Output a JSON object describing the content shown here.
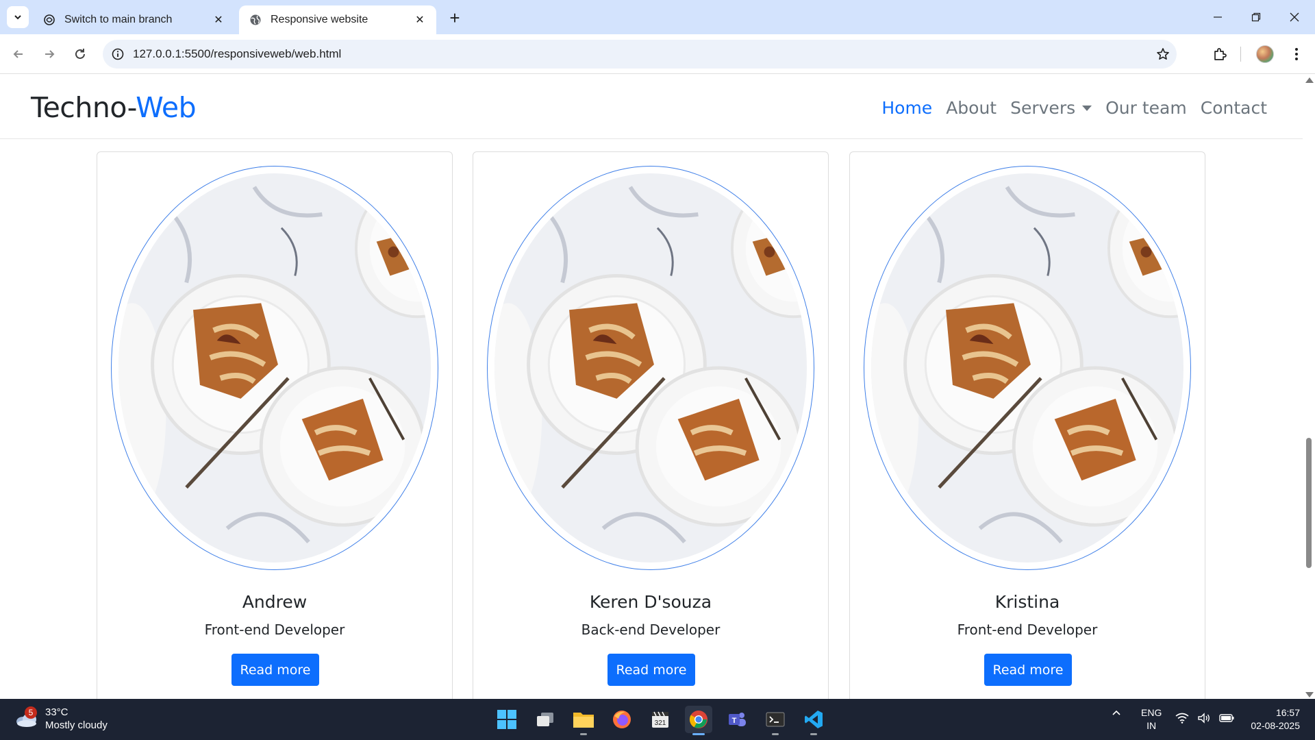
{
  "browser": {
    "tabs": [
      {
        "title": "Switch to main branch",
        "icon": "chatgpt-icon",
        "active": false
      },
      {
        "title": "Responsive website",
        "icon": "globe-icon",
        "active": true
      }
    ],
    "url": "127.0.0.1:5500/responsiveweb/web.html"
  },
  "site": {
    "brand": {
      "main": "Techno-",
      "accent": "Web"
    },
    "nav": {
      "home": "Home",
      "about": "About",
      "servers": "Servers",
      "team": "Our team",
      "contact": "Contact"
    },
    "accent_color": "#0d6efd"
  },
  "team": [
    {
      "name": "Andrew",
      "role": "Front-end Developer",
      "button": "Read more"
    },
    {
      "name": "Keren D'souza",
      "role": "Back-end Developer",
      "button": "Read more"
    },
    {
      "name": "Kristina",
      "role": "Front-end Developer",
      "button": "Read more"
    }
  ],
  "taskbar": {
    "weather": {
      "temp": "33°C",
      "desc": "Mostly cloudy",
      "badge": "5"
    },
    "lang": {
      "line1": "ENG",
      "line2": "IN"
    },
    "clock": {
      "time": "16:57",
      "date": "02-08-2025"
    }
  }
}
